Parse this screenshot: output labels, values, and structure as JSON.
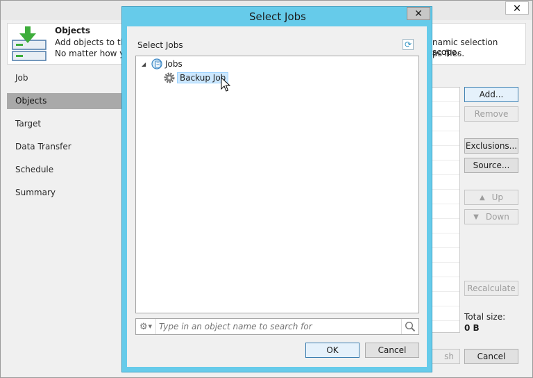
{
  "background_window": {
    "close_label": "✕",
    "header": {
      "title": "Objects",
      "desc_line1": "Add objects to the",
      "desc_line2": "No matter how yo",
      "desc_line1_right": "namic selection scope.",
      "desc_line2_right": "ps files."
    },
    "nav": [
      {
        "label": "Job",
        "active": false
      },
      {
        "label": "Objects",
        "active": true
      },
      {
        "label": "Target",
        "active": false
      },
      {
        "label": "Data Transfer",
        "active": false
      },
      {
        "label": "Schedule",
        "active": false
      },
      {
        "label": "Summary",
        "active": false
      }
    ],
    "buttons": {
      "add": "Add...",
      "remove": "Remove",
      "exclusions": "Exclusions...",
      "source": "Source...",
      "up": "Up",
      "down": "Down",
      "recalculate": "Recalculate",
      "finish_partial": "sh",
      "cancel": "Cancel"
    },
    "total_size_label": "Total size:",
    "total_size_value": "0 B"
  },
  "dialog": {
    "title": "Select Jobs",
    "close_label": "✕",
    "section_label": "Select Jobs",
    "tree": {
      "root": {
        "label": "Jobs",
        "expanded": true
      },
      "children": [
        {
          "label": "Backup Job",
          "selected": true
        }
      ]
    },
    "search": {
      "placeholder": "Type in an object name to search for",
      "value": ""
    },
    "buttons": {
      "ok": "OK",
      "cancel": "Cancel"
    }
  },
  "colors": {
    "dialog_frame": "#66cbea",
    "nav_active": "#a9a9a9",
    "selection": "#cce8ff",
    "icon_green": "#3dad3b"
  }
}
